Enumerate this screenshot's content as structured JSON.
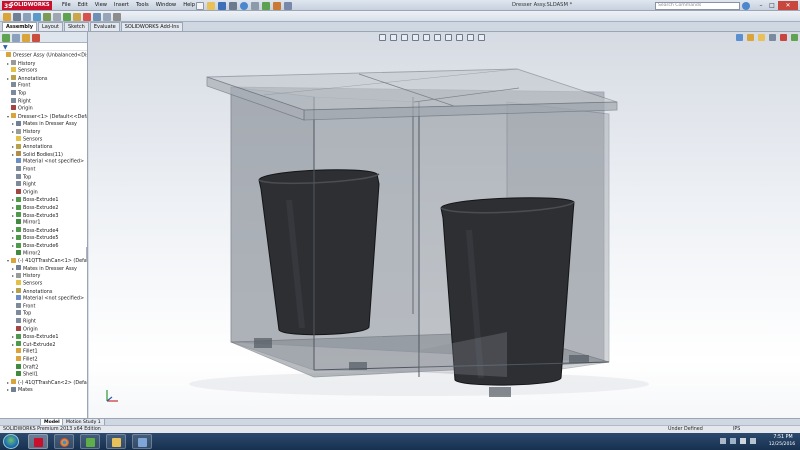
{
  "app": {
    "logo_text": "SOLIDWORKS",
    "logo_ds": "3S",
    "menus": [
      "File",
      "Edit",
      "View",
      "Insert",
      "Tools",
      "Window",
      "Help"
    ],
    "document_title": "Dresser Assy.SLDASM *",
    "search_placeholder": "Search Commands",
    "window_buttons": {
      "minimize": "–",
      "maximize": "□",
      "close": "✕"
    }
  },
  "command_manager": {
    "tabs": [
      "Assembly",
      "Layout",
      "Sketch",
      "Evaluate",
      "SOLIDWORKS Add-Ins"
    ],
    "active_tab": "Assembly"
  },
  "feature_tree": {
    "items": [
      {
        "label": "Dresser Assy  (Unbalanced<Display",
        "level": 0,
        "icon": "assembly-icon",
        "color": "#d9a43a",
        "expander": ""
      },
      {
        "label": "History",
        "level": 1,
        "icon": "history-icon",
        "color": "#9a9a9a",
        "expander": "▸"
      },
      {
        "label": "Sensors",
        "level": 1,
        "icon": "sensor-icon",
        "color": "#e5c047",
        "expander": ""
      },
      {
        "label": "Annotations",
        "level": 1,
        "icon": "annotation-icon",
        "color": "#b8a14a",
        "expander": "▸"
      },
      {
        "label": "Front",
        "level": 1,
        "icon": "plane-icon",
        "color": "#7d8a9c",
        "expander": ""
      },
      {
        "label": "Top",
        "level": 1,
        "icon": "plane-icon",
        "color": "#7d8a9c",
        "expander": ""
      },
      {
        "label": "Right",
        "level": 1,
        "icon": "plane-icon",
        "color": "#7d8a9c",
        "expander": ""
      },
      {
        "label": "Origin",
        "level": 1,
        "icon": "origin-icon",
        "color": "#a04444",
        "expander": ""
      },
      {
        "label": "Dresser<1> (Default<<Default>",
        "level": 1,
        "icon": "part-icon",
        "color": "#d9a43a",
        "expander": "▾"
      },
      {
        "label": "Mates in Dresser Assy",
        "level": 2,
        "icon": "mates-icon",
        "color": "#6f7f95",
        "expander": "▸"
      },
      {
        "label": "History",
        "level": 2,
        "icon": "history-icon",
        "color": "#9a9a9a",
        "expander": "▸"
      },
      {
        "label": "Sensors",
        "level": 2,
        "icon": "sensor-icon",
        "color": "#e5c047",
        "expander": ""
      },
      {
        "label": "Annotations",
        "level": 2,
        "icon": "annotation-icon",
        "color": "#b8a14a",
        "expander": "▸"
      },
      {
        "label": "Solid Bodies(11)",
        "level": 2,
        "icon": "solid-bodies-icon",
        "color": "#b38b4d",
        "expander": "▸"
      },
      {
        "label": "Material <not specified>",
        "level": 2,
        "icon": "material-icon",
        "color": "#6b8ec7",
        "expander": ""
      },
      {
        "label": "Front",
        "level": 2,
        "icon": "plane-icon",
        "color": "#7d8a9c",
        "expander": ""
      },
      {
        "label": "Top",
        "level": 2,
        "icon": "plane-icon",
        "color": "#7d8a9c",
        "expander": ""
      },
      {
        "label": "Right",
        "level": 2,
        "icon": "plane-icon",
        "color": "#7d8a9c",
        "expander": ""
      },
      {
        "label": "Origin",
        "level": 2,
        "icon": "origin-icon",
        "color": "#a04444",
        "expander": ""
      },
      {
        "label": "Boss-Extrude1",
        "level": 2,
        "icon": "extrude-icon",
        "color": "#4f9a4a",
        "expander": "▸"
      },
      {
        "label": "Boss-Extrude2",
        "level": 2,
        "icon": "extrude-icon",
        "color": "#4f9a4a",
        "expander": "▸"
      },
      {
        "label": "Boss-Extrude3",
        "level": 2,
        "icon": "extrude-icon",
        "color": "#4f9a4a",
        "expander": "▸"
      },
      {
        "label": "Mirror1",
        "level": 2,
        "icon": "mirror-icon",
        "color": "#3f8a3f",
        "expander": ""
      },
      {
        "label": "Boss-Extrude4",
        "level": 2,
        "icon": "extrude-icon",
        "color": "#4f9a4a",
        "expander": "▸"
      },
      {
        "label": "Boss-Extrude5",
        "level": 2,
        "icon": "extrude-icon",
        "color": "#4f9a4a",
        "expander": "▸"
      },
      {
        "label": "Boss-Extrude6",
        "level": 2,
        "icon": "extrude-icon",
        "color": "#4f9a4a",
        "expander": "▸"
      },
      {
        "label": "Mirror2",
        "level": 2,
        "icon": "mirror-icon",
        "color": "#3f8a3f",
        "expander": ""
      },
      {
        "label": "(-) 41QTTrashCan<1> (Default<",
        "level": 1,
        "icon": "part-icon",
        "color": "#d9a43a",
        "expander": "▾"
      },
      {
        "label": "Mates in Dresser Assy",
        "level": 2,
        "icon": "mates-icon",
        "color": "#6f7f95",
        "expander": "▸"
      },
      {
        "label": "History",
        "level": 2,
        "icon": "history-icon",
        "color": "#9a9a9a",
        "expander": "▸"
      },
      {
        "label": "Sensors",
        "level": 2,
        "icon": "sensor-icon",
        "color": "#e5c047",
        "expander": ""
      },
      {
        "label": "Annotations",
        "level": 2,
        "icon": "annotation-icon",
        "color": "#b8a14a",
        "expander": "▸"
      },
      {
        "label": "Material <not specified>",
        "level": 2,
        "icon": "material-icon",
        "color": "#6b8ec7",
        "expander": ""
      },
      {
        "label": "Front",
        "level": 2,
        "icon": "plane-icon",
        "color": "#7d8a9c",
        "expander": ""
      },
      {
        "label": "Top",
        "level": 2,
        "icon": "plane-icon",
        "color": "#7d8a9c",
        "expander": ""
      },
      {
        "label": "Right",
        "level": 2,
        "icon": "plane-icon",
        "color": "#7d8a9c",
        "expander": ""
      },
      {
        "label": "Origin",
        "level": 2,
        "icon": "origin-icon",
        "color": "#a04444",
        "expander": ""
      },
      {
        "label": "Boss-Extrude1",
        "level": 2,
        "icon": "extrude-icon",
        "color": "#4f9a4a",
        "expander": "▸"
      },
      {
        "label": "Cut-Extrude2",
        "level": 2,
        "icon": "cut-icon",
        "color": "#4f9a4a",
        "expander": "▸"
      },
      {
        "label": "Fillet1",
        "level": 2,
        "icon": "fillet-icon",
        "color": "#d9a43a",
        "expander": ""
      },
      {
        "label": "Fillet2",
        "level": 2,
        "icon": "fillet-icon",
        "color": "#d9a43a",
        "expander": ""
      },
      {
        "label": "Draft2",
        "level": 2,
        "icon": "draft-icon",
        "color": "#3f8a3f",
        "expander": ""
      },
      {
        "label": "Shell1",
        "level": 2,
        "icon": "shell-icon",
        "color": "#3f8a3f",
        "expander": ""
      },
      {
        "label": "(-) 41QTTrashCan<2> (Default<",
        "level": 1,
        "icon": "part-icon",
        "color": "#d9a43a",
        "expander": "▸"
      },
      {
        "label": "Mates",
        "level": 1,
        "icon": "mates-icon",
        "color": "#6f7f95",
        "expander": "▸"
      }
    ]
  },
  "bottom_tabs": [
    "Model",
    "Motion Study 1"
  ],
  "status_bar": {
    "left": "SOLIDWORKS Premium 2013 x64 Edition",
    "mid": "Under Defined",
    "units": "IPS"
  },
  "taskbar": {
    "time": "7:51 PM",
    "date": "12/25/2016"
  },
  "colors": {
    "accent": "#c8102e",
    "viewport_top": "#d6dbe3",
    "taskbar": "#1f3a5c"
  }
}
